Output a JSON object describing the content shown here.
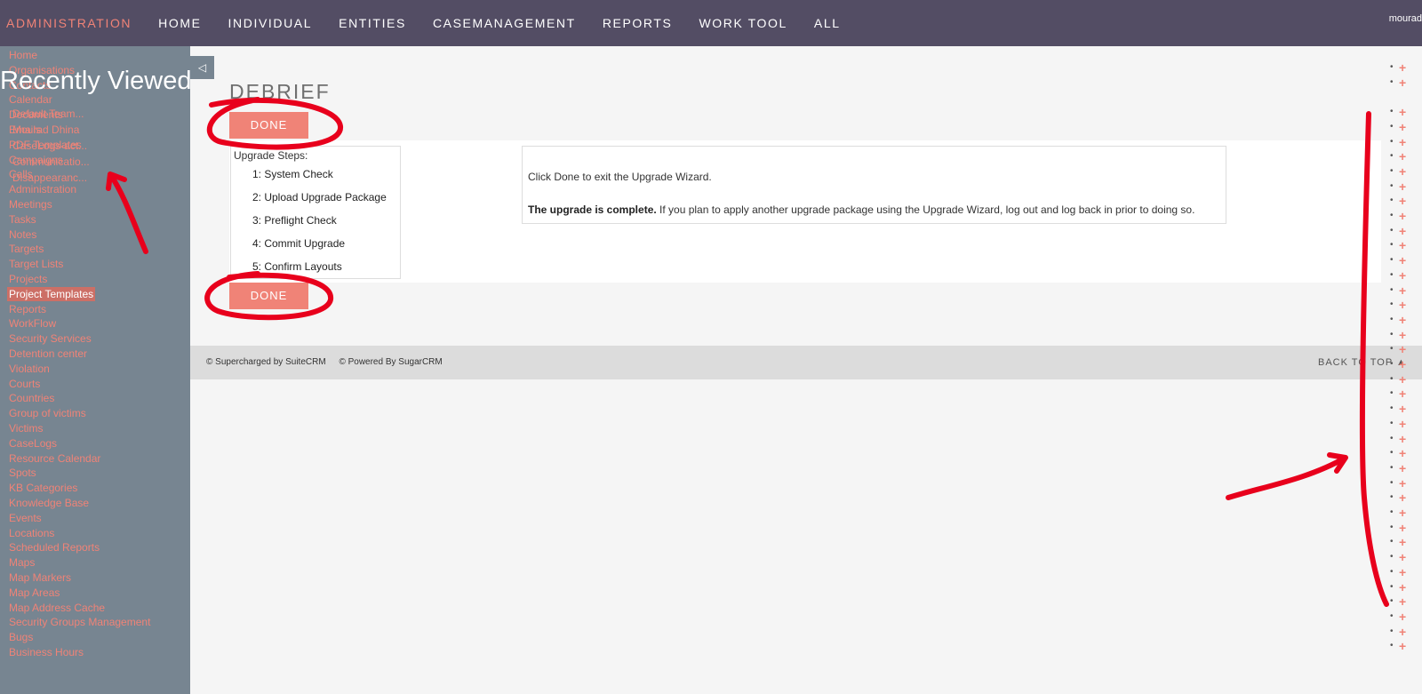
{
  "topnav": {
    "items": [
      "ADMINISTRATION",
      "HOME",
      "INDIVIDUAL",
      "ENTITIES",
      "CASEMANAGEMENT",
      "REPORTS",
      "WORK TOOL",
      "ALL"
    ],
    "user": "mourad"
  },
  "sidebar": {
    "items": [
      "Home",
      "Organisations",
      "Contacts",
      "Calendar",
      "Documents",
      "Emails",
      "PDF Templates",
      "Campaigns",
      "Calls",
      "Administration",
      "Meetings",
      "Tasks",
      "Notes",
      "Targets",
      "Target Lists",
      "Projects",
      "Project Templates",
      "Reports",
      "WorkFlow",
      "Security Services",
      "Detention center",
      "Violation",
      "Courts",
      "Countries",
      "Group of victims",
      "Victims",
      "CaseLogs",
      "Resource Calendar",
      "Spots",
      "KB Categories",
      "Knowledge Base",
      "Events",
      "Locations",
      "Scheduled Reports",
      "Maps",
      "Map Markers",
      "Map Areas",
      "Map Address Cache",
      "Security Groups Management",
      "Bugs",
      "Business Hours"
    ],
    "active": "Project Templates",
    "recent_title": "Recently Viewed",
    "recent_items": [
      "Default Team...",
      "Mourad Dhina",
      "CaseLogs-act...",
      "Communicatio...",
      "Disappearanc..."
    ]
  },
  "collapse_icon": "◁",
  "page": {
    "title": "DEBRIEF",
    "done_label": "DONE",
    "steps_title": "Upgrade Steps:",
    "steps": [
      "1: System Check",
      "2: Upload Upgrade Package",
      "3: Preflight Check",
      "4: Commit Upgrade",
      "5: Confirm Layouts"
    ],
    "message1": "Click Done to exit the Upgrade Wizard.",
    "message2_bold": "The upgrade is complete.",
    "message2_rest": " If you plan to apply another upgrade package using the Upgrade Wizard, log out and log back in prior to doing so."
  },
  "footer": {
    "supercharged": "© Supercharged by SuiteCRM",
    "powered": "© Powered By SugarCRM",
    "back_to_top": "BACK TO TOP ▲"
  },
  "colors": {
    "nav_bg": "#534d64",
    "sidebar_bg": "#778591",
    "accent": "#f08377",
    "annotation": "#e8001c"
  }
}
